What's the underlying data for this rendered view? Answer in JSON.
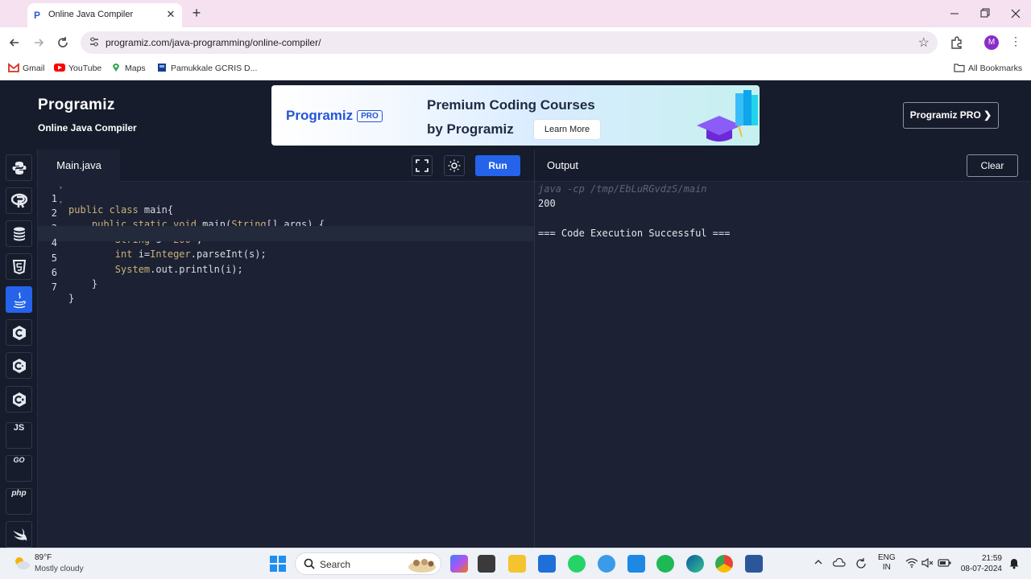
{
  "browser": {
    "tab_title": "Online Java Compiler",
    "tab_favicon": "P",
    "tab_list_icon": "chevron-down-icon",
    "new_tab_glyph": "+",
    "close_tab_glyph": "✕",
    "url": "programiz.com/java-programming/online-compiler/",
    "profile_initial": "M",
    "bookmarks": [
      {
        "label": "Gmail"
      },
      {
        "label": "YouTube"
      },
      {
        "label": "Maps"
      },
      {
        "label": "Pamukkale GCRIS D..."
      }
    ],
    "all_bookmarks": "All Bookmarks"
  },
  "header": {
    "logo": "Programiz",
    "subtitle": "Online Java Compiler",
    "banner": {
      "brand": "Programiz",
      "badge": "PRO",
      "line1": "Premium Coding Courses",
      "line2": "by Programiz",
      "cta": "Learn More"
    },
    "pro_button": "Programiz PRO ❯"
  },
  "sidebar": {
    "languages": [
      {
        "name": "python",
        "glyph": "🐍"
      },
      {
        "name": "r",
        "glyph": "R"
      },
      {
        "name": "sql",
        "glyph": "≣"
      },
      {
        "name": "html",
        "glyph": "5"
      },
      {
        "name": "java",
        "glyph": "♨",
        "active": true
      },
      {
        "name": "c",
        "glyph": "C"
      },
      {
        "name": "cpp",
        "glyph": "C"
      },
      {
        "name": "csharp",
        "glyph": "C"
      },
      {
        "name": "js",
        "glyph": "JS"
      },
      {
        "name": "go",
        "glyph": "GO"
      },
      {
        "name": "php",
        "glyph": "php"
      },
      {
        "name": "swift",
        "glyph": "➹"
      }
    ]
  },
  "editor": {
    "file_name": "Main.java",
    "run_label": "Run",
    "lines": [
      {
        "n": "1",
        "fold": true
      },
      {
        "n": "2",
        "fold": true
      },
      {
        "n": "3"
      },
      {
        "n": "4",
        "current": true
      },
      {
        "n": "5"
      },
      {
        "n": "6"
      },
      {
        "n": "7"
      }
    ],
    "code": {
      "l1a": "public class",
      "l1b": " main{",
      "l2a": "    public static void",
      "l2b": " main(",
      "l2c": "String",
      "l2d": "[] args) {",
      "l3a": "        String",
      "l3b": " s=",
      "l3c": "\"200\"",
      "l3d": ";",
      "l4a": "        int",
      "l4b": " i=",
      "l4c": "Integer",
      "l4d": ".parseInt(s);",
      "l5a": "        ",
      "l5b": "System",
      "l5c": ".out.println(i);",
      "l6": "    }",
      "l7": "}"
    }
  },
  "output": {
    "title": "Output",
    "clear_label": "Clear",
    "lines": [
      "java -cp /tmp/EbLuRGvdzS/main",
      "200",
      "",
      "=== Code Execution Successful ==="
    ]
  },
  "taskbar": {
    "temperature": "89°F",
    "weather": "Mostly cloudy",
    "search_label": "Search",
    "language_top": "ENG",
    "language_bottom": "IN",
    "time": "21:59",
    "date": "08-07-2024"
  },
  "colors": {
    "accent": "#2563eb",
    "background": "#1c2233",
    "header": "#161c2b"
  }
}
